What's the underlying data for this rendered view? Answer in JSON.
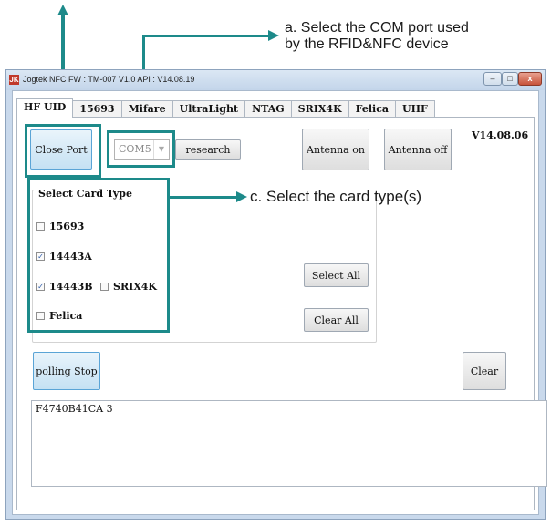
{
  "annotations": {
    "com_port_note": [
      "a. Select the COM port used",
      "by the RFID&NFC device"
    ],
    "card_type_note": "c. Select the card type(s)",
    "color": "#1d8a8a"
  },
  "window": {
    "icon_text": "JK",
    "title": "Jogtek NFC   FW : TM-007 V1.0   API : V14.08.19",
    "controls": {
      "minimize": "–",
      "maximize": "□",
      "close": "x"
    }
  },
  "tabs": [
    "HF UID",
    "15693",
    "Mifare",
    "UltraLight",
    "NTAG",
    "SRIX4K",
    "Felica",
    "UHF"
  ],
  "active_tab": "HF UID",
  "toolbar": {
    "close_port_label": "Close Port",
    "com_port_value": "COM5",
    "research_label": "research",
    "antenna_on_label": "Antenna on",
    "antenna_off_label": "Antenna off",
    "version": "V14.08.06"
  },
  "card_types": {
    "legend": "Select Card Type",
    "items": [
      {
        "label": "15693",
        "checked": false
      },
      {
        "label": "14443A",
        "checked": true
      },
      {
        "label": "14443B",
        "checked": true
      },
      {
        "label": "SRIX4K",
        "checked": false
      },
      {
        "label": "Felica",
        "checked": false
      }
    ],
    "select_all_label": "Select All",
    "clear_all_label": "Clear All",
    "check_glyph": "✓"
  },
  "polling": {
    "polling_label": "polling Stop",
    "clear_label": "Clear"
  },
  "output": {
    "text": "F4740B41CA 3"
  }
}
